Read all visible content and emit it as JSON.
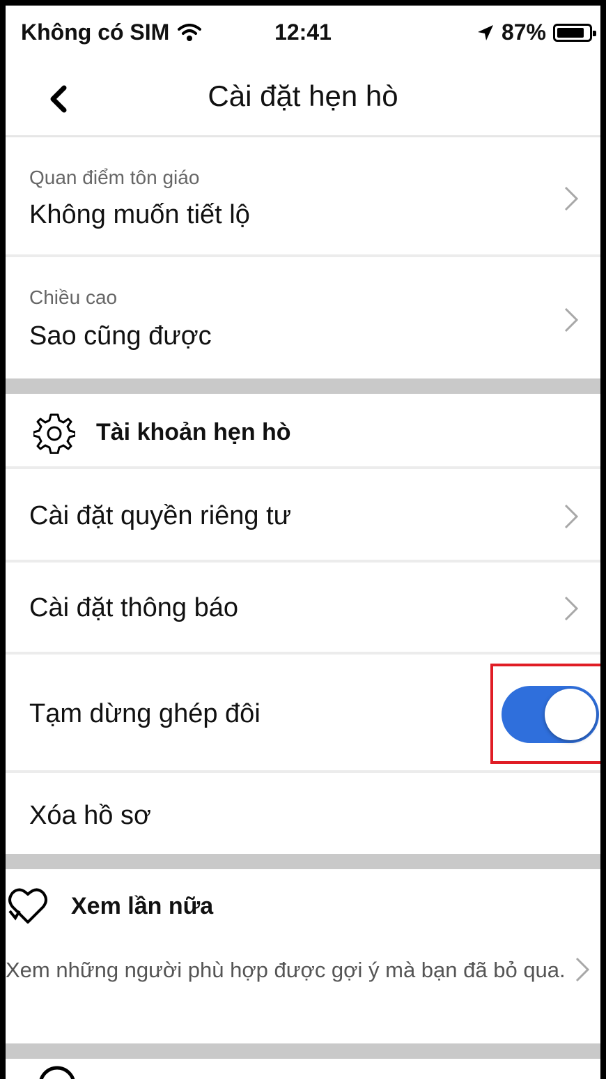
{
  "status_bar": {
    "carrier": "Không có SIM",
    "time": "12:41",
    "battery_percent": "87%"
  },
  "nav": {
    "title": "Cài đặt hẹn hò",
    "back_icon": "chevron-left-icon"
  },
  "preferences": [
    {
      "label": "Quan điểm tôn giáo",
      "value": "Không muốn tiết lộ"
    },
    {
      "label": "Chiều cao",
      "value": "Sao cũng được"
    }
  ],
  "account_section": {
    "icon": "gear-icon",
    "title": "Tài khoản hẹn hò",
    "items": [
      {
        "label": "Cài đặt quyền riêng tư"
      },
      {
        "label": "Cài đặt thông báo"
      },
      {
        "label": "Tạm dừng ghép đôi",
        "toggle_on": true
      },
      {
        "label": "Xóa hồ sơ",
        "color": "#e5343d"
      }
    ]
  },
  "second_look": {
    "icon": "heart-return-icon",
    "title": "Xem lần nữa",
    "description": "Xem những người phù hợp được gợi ý mà bạn đã bỏ qua."
  },
  "colors": {
    "toggle_on": "#2f6fdc",
    "highlight_box": "#e01d25",
    "danger": "#e5343d"
  }
}
